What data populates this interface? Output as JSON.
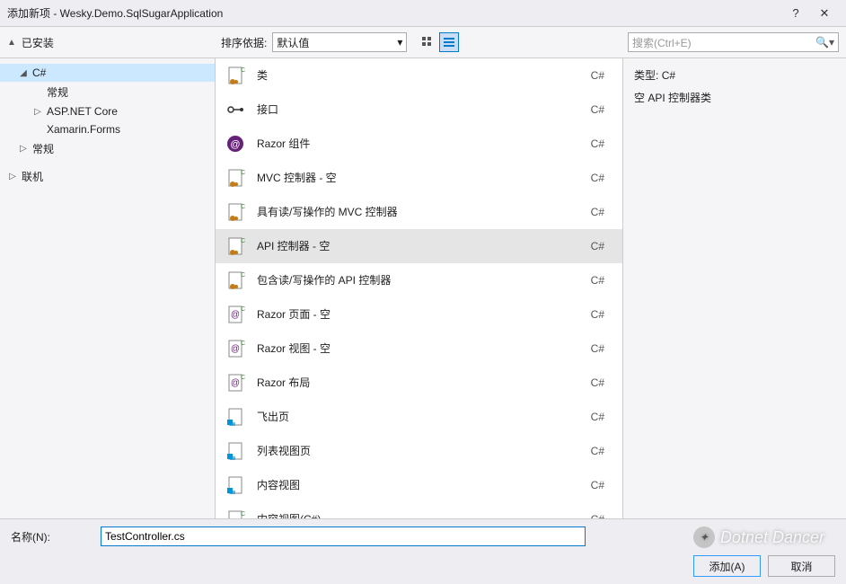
{
  "window": {
    "title": "添加新项 - Wesky.Demo.SqlSugarApplication",
    "help": "?",
    "close": "✕"
  },
  "toolbar": {
    "installed_root": "已安装",
    "sort_label": "排序依据:",
    "sort_value": "默认值",
    "search_placeholder": "搜索(Ctrl+E)"
  },
  "sidebar": {
    "items": [
      {
        "label": "已安装",
        "expanded": true,
        "level": 0
      },
      {
        "label": "C#",
        "expanded": true,
        "level": 1,
        "selected": true
      },
      {
        "label": "常规",
        "level": 2
      },
      {
        "label": "ASP.NET Core",
        "level": 2,
        "hasChildren": true
      },
      {
        "label": "Xamarin.Forms",
        "level": 2
      },
      {
        "label": "常规",
        "level": 1,
        "hasChildren": true
      },
      {
        "label": "联机",
        "level": 0,
        "hasChildren": true
      }
    ]
  },
  "templates": [
    {
      "name": "类",
      "lang": "C#",
      "icon": "cs-class"
    },
    {
      "name": "接口",
      "lang": "C#",
      "icon": "interface"
    },
    {
      "name": "Razor 组件",
      "lang": "C#",
      "icon": "razor-comp"
    },
    {
      "name": "MVC 控制器 - 空",
      "lang": "C#",
      "icon": "cs-class"
    },
    {
      "name": "具有读/写操作的 MVC 控制器",
      "lang": "C#",
      "icon": "cs-class"
    },
    {
      "name": "API 控制器 - 空",
      "lang": "C#",
      "icon": "cs-class",
      "selected": true
    },
    {
      "name": "包含读/写操作的 API 控制器",
      "lang": "C#",
      "icon": "cs-class"
    },
    {
      "name": "Razor 页面 - 空",
      "lang": "C#",
      "icon": "razor-page"
    },
    {
      "name": "Razor 视图 - 空",
      "lang": "C#",
      "icon": "razor-page"
    },
    {
      "name": "Razor 布局",
      "lang": "C#",
      "icon": "razor-page"
    },
    {
      "name": "飞出页",
      "lang": "C#",
      "icon": "page"
    },
    {
      "name": "列表视图页",
      "lang": "C#",
      "icon": "page"
    },
    {
      "name": "内容视图",
      "lang": "C#",
      "icon": "page"
    },
    {
      "name": "内容视图(C#)",
      "lang": "C#",
      "icon": "cs-class"
    }
  ],
  "details": {
    "type_label": "类型:",
    "type_value": "C#",
    "description": "空 API 控制器类"
  },
  "bottom": {
    "name_label": "名称(N):",
    "name_value": "TestController.cs",
    "add_btn": "添加(A)",
    "cancel_btn": "取消"
  },
  "watermark": "Dotnet Dancer"
}
